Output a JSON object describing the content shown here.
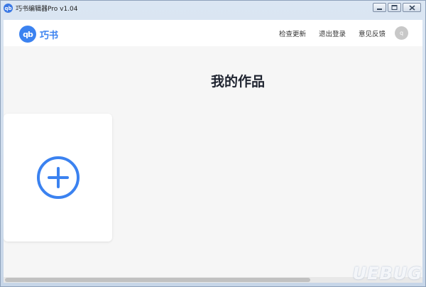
{
  "window": {
    "title": "巧书编辑器Pro v1.04",
    "icon_text": "qb"
  },
  "header": {
    "logo_mark": "qb",
    "logo_text": "巧书",
    "nav": [
      {
        "label": "检查更新"
      },
      {
        "label": "退出登录"
      },
      {
        "label": "意见反馈"
      }
    ],
    "avatar_text": "q"
  },
  "main": {
    "title": "我的作品",
    "add_card_icon": "plus-circle-icon"
  },
  "watermark": "UEBUG",
  "colors": {
    "accent": "#3b82f0",
    "page_bg": "#f6f6f6",
    "card_bg": "#ffffff",
    "avatar_bg": "#c8c8c8"
  }
}
